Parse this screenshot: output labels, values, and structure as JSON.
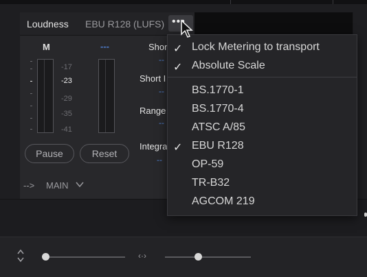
{
  "meter": {
    "tab_title": "Loudness",
    "standard_label": "EBU R128 (LUFS)",
    "more_label": "•••",
    "channel_m": "M",
    "channel_other": "---",
    "scale": [
      "-17",
      "-23",
      "-29",
      "-35",
      "-41"
    ],
    "scale_active": "-23",
    "pause_label": "Pause",
    "reset_label": "Reset",
    "short_term_label": "Short",
    "short_i_label": "Short I",
    "range_label": "Range",
    "integrated_label": "Integra",
    "empty_value": "--",
    "colors": {
      "value_blue": "#4f7fd0",
      "panel": "#28282b"
    }
  },
  "routing": {
    "arrow": "-->",
    "label": "MAIN"
  },
  "menu": {
    "options": [
      {
        "label": "Lock Metering to transport",
        "checked": true
      },
      {
        "label": "Absolute Scale",
        "checked": true
      }
    ],
    "standards": [
      {
        "label": "BS.1770-1",
        "checked": false
      },
      {
        "label": "BS.1770-4",
        "checked": false
      },
      {
        "label": "ATSC A/85",
        "checked": false
      },
      {
        "label": "EBU R128",
        "checked": true
      },
      {
        "label": "OP-59",
        "checked": false
      },
      {
        "label": "TR-B32",
        "checked": false
      },
      {
        "label": "AGCOM 219",
        "checked": false
      }
    ],
    "check_glyph": "✓"
  },
  "bottom": {
    "pan_icon": "‹·›"
  }
}
